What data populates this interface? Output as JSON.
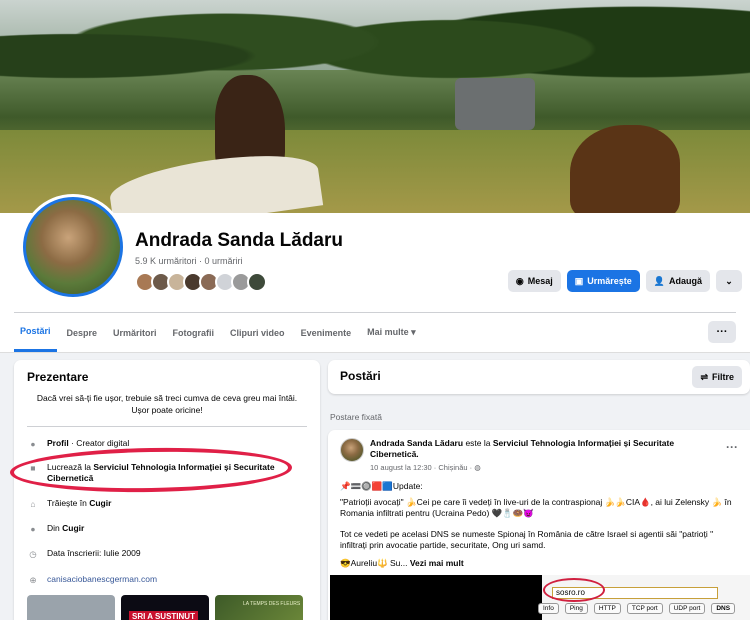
{
  "profile": {
    "name": "Andrada Sanda Lădaru",
    "followers": "5.9 K urmăritori · 0 urmăriri"
  },
  "actions": {
    "message": "Mesaj",
    "follow": "Urmărește",
    "add": "Adaugă"
  },
  "tabs": [
    "Postări",
    "Despre",
    "Urmăritori",
    "Fotografii",
    "Clipuri video",
    "Evenimente",
    "Mai multe ▾"
  ],
  "intro": {
    "title": "Prezentare",
    "bio": "Dacă vrei să-ți fie ușor, trebuie să treci cumva de ceva greu mai întâi. Ușor poate oricine!",
    "profile_label": "Profil",
    "profile_value": "· Creator digital",
    "work_prefix": "Lucrează la",
    "work_place": "Serviciul Tehnologia Informației și Securitate Cibernetică",
    "lives_prefix": "Trăiește în",
    "lives_place": "Cugir",
    "from_prefix": "Din",
    "from_place": "Cugir",
    "joined": "Data înscrierii: Iulie 2009",
    "website": "canisaciobanescgerman.com",
    "photo2_text": "SRI A SUSTINUT",
    "photo3_text": "LA TEMPS DES FLEURS"
  },
  "posts": {
    "title": "Postări",
    "filter": "Filtre",
    "pinned_label": "Postare fixată",
    "author": "Andrada Sanda Lădaru",
    "is_at": "este la",
    "place": "Serviciul Tehnologia Informației și Securitate Cibernetică.",
    "meta": "10 august la 12:30 · Chișinău · ◍",
    "line1": "📌🟰🔘🟥🟦Update:",
    "line2": "\"Patrioții avocați\" 🍌Cei pe care îi vedeți în live-uri  de la contraspionaj 🍌🍌CIA🩸, ai lui Zelensky 🍌 în Romania infiltrati pentru (Ucraina Pedo) 🖤🧂🍩😈",
    "line3": "Tot ce vedeti pe acelasi DNS se numeste Spionaj în România de către Israel si agentii săi \"patrioți \" infiltrați prin avocatie partide, securitate, Ong uri samd.",
    "line4_prefix": "😎Aureliu🔱 Su...",
    "line4_more": "Vezi mai mult"
  },
  "tool": {
    "input_value": "sosro.ro",
    "buttons": [
      "Info",
      "Ping",
      "HTTP",
      "TCP port",
      "UDP port",
      "DNS"
    ]
  },
  "colors": {
    "accent": "#1b74e4",
    "highlight": "#e02047"
  }
}
